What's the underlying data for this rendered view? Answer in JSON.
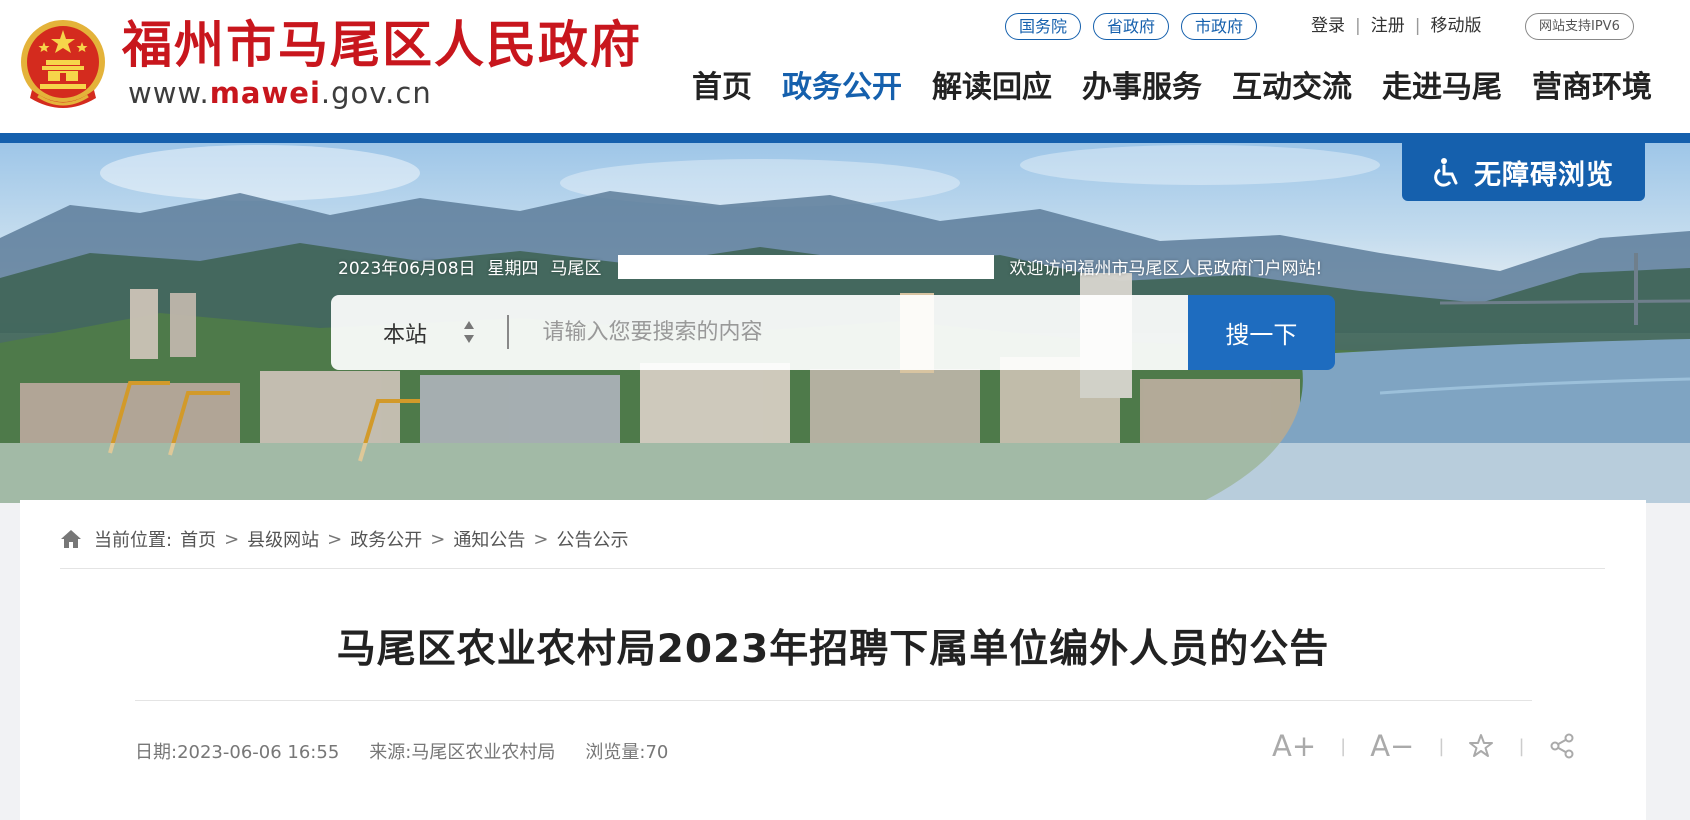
{
  "header": {
    "title": "福州市马尾区人民政府",
    "url_prefix": "www.",
    "url_domain": "mawei",
    "url_suffix": ".gov.cn",
    "gov_links": [
      "国务院",
      "省政府",
      "市政府"
    ],
    "user_links": [
      "登录",
      "注册",
      "移动版"
    ],
    "ipv6_badge": "网站支持IPV6",
    "nav": [
      "首页",
      "政务公开",
      "解读回应",
      "办事服务",
      "互动交流",
      "走进马尾",
      "营商环境"
    ],
    "active_nav": "政务公开",
    "brand_color": "#c8161d",
    "accent_color": "#1560ad"
  },
  "banner": {
    "accessibility_label": "无障碍浏览",
    "date": "2023年06月08日",
    "weekday": "星期四",
    "district": "马尾区",
    "welcome": "欢迎访问福州市马尾区人民政府门户网站!"
  },
  "search": {
    "scope": "本站",
    "placeholder": "请输入您要搜索的内容",
    "button": "搜一下"
  },
  "breadcrumb": {
    "prefix": "当前位置:",
    "items": [
      "首页",
      "县级网站",
      "政务公开",
      "通知公告",
      "公告公示"
    ]
  },
  "article": {
    "title": "马尾区农业农村局2023年招聘下属单位编外人员的公告",
    "date_label": "日期:",
    "date": "2023-06-06 16:55",
    "source_label": "来源:",
    "source": "马尾区农业农村局",
    "views_label": "浏览量:",
    "views": "70"
  },
  "tools": {
    "font_increase": "A+",
    "font_decrease": "A−",
    "favorite_icon": "star-icon",
    "share_icon": "share-icon"
  }
}
